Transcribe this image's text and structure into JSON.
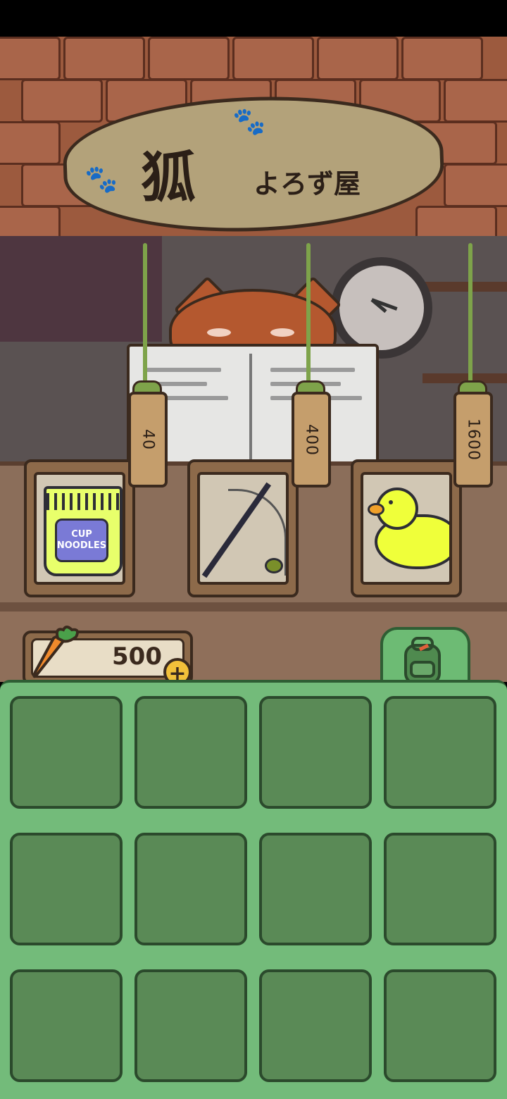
{
  "shop": {
    "sign_title": "狐",
    "sign_subtitle": "よろず屋",
    "items": [
      {
        "name": "cup noodles",
        "price": "40",
        "label": "CUP NOODLES"
      },
      {
        "name": "fishing rod",
        "price": "400"
      },
      {
        "name": "rubber duck",
        "price": "1600"
      }
    ]
  },
  "currency": {
    "icon": "carrot-icon",
    "amount": "500",
    "add_label": "+"
  },
  "inventory": {
    "tab_icon": "backpack-icon",
    "rows": 3,
    "cols": 4
  }
}
